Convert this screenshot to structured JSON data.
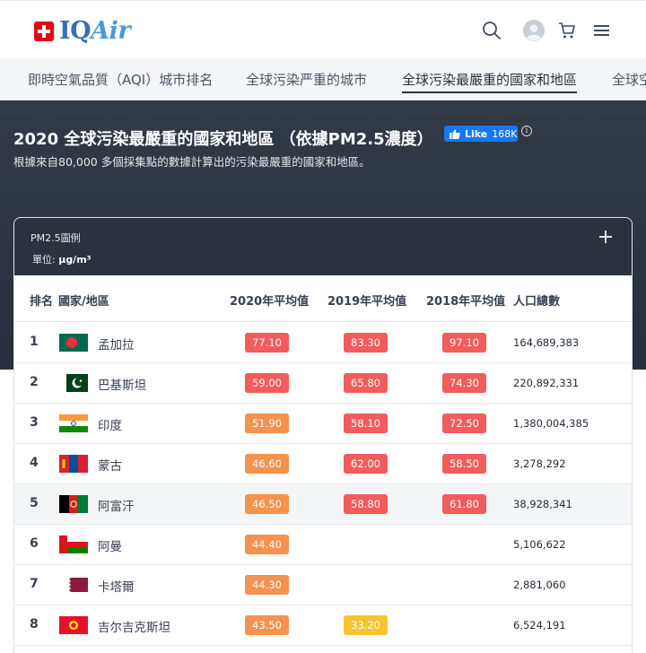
{
  "brand": {
    "name_iq": "IQ",
    "name_air": "Air",
    "flag_color": "#e30613"
  },
  "header_icons": [
    "search-icon",
    "user-avatar-icon",
    "cart-icon",
    "menu-icon"
  ],
  "tabs": [
    {
      "label": "即時空氣品質（AQI）城市排名",
      "active": false
    },
    {
      "label": "全球污染严重的城市",
      "active": false
    },
    {
      "label": "全球污染最嚴重的國家和地區",
      "active": true
    },
    {
      "label": "全球空",
      "active": false
    }
  ],
  "hero": {
    "title": "2020 全球污染最嚴重的國家和地區 （依據PM2.5濃度）",
    "like_label": "Like",
    "like_count": "168K",
    "info_symbol": "i",
    "subtitle": "根據來自80,000 多個採集點的數據計算出的污染最嚴重的國家和地區。"
  },
  "legend": {
    "title": "PM2.5圖例",
    "unit_label": "單位:",
    "unit": "µg/m³"
  },
  "table": {
    "headers": {
      "rank": "排名",
      "country": "國家/地區",
      "y2020": "2020年平均值",
      "y2019": "2019年平均值",
      "y2018": "2018年平均值",
      "population": "人口總數"
    },
    "rows": [
      {
        "rank": "1",
        "flag": "bangladesh",
        "name": "孟加拉",
        "y2020": "77.10",
        "y2019": "83.30",
        "y2018": "97.10",
        "population": "164,689,383",
        "c2020": "red",
        "c2019": "red",
        "c2018": "red"
      },
      {
        "rank": "2",
        "flag": "pakistan",
        "name": "巴基斯坦",
        "y2020": "59.00",
        "y2019": "65.80",
        "y2018": "74.30",
        "population": "220,892,331",
        "c2020": "red",
        "c2019": "red",
        "c2018": "red"
      },
      {
        "rank": "3",
        "flag": "india",
        "name": "印度",
        "y2020": "51.90",
        "y2019": "58.10",
        "y2018": "72.50",
        "population": "1,380,004,385",
        "c2020": "orange",
        "c2019": "red",
        "c2018": "red"
      },
      {
        "rank": "4",
        "flag": "mongolia",
        "name": "蒙古",
        "y2020": "46.60",
        "y2019": "62.00",
        "y2018": "58.50",
        "population": "3,278,292",
        "c2020": "orange",
        "c2019": "red",
        "c2018": "red"
      },
      {
        "rank": "5",
        "flag": "afghanistan",
        "name": "阿富汗",
        "y2020": "46.50",
        "y2019": "58.80",
        "y2018": "61.80",
        "population": "38,928,341",
        "c2020": "orange",
        "c2019": "red",
        "c2018": "red"
      },
      {
        "rank": "6",
        "flag": "oman",
        "name": "阿曼",
        "y2020": "44.40",
        "y2019": "",
        "y2018": "",
        "population": "5,106,622",
        "c2020": "orange",
        "c2019": "",
        "c2018": ""
      },
      {
        "rank": "7",
        "flag": "qatar",
        "name": "卡塔爾",
        "y2020": "44.30",
        "y2019": "",
        "y2018": "",
        "population": "2,881,060",
        "c2020": "orange",
        "c2019": "",
        "c2018": ""
      },
      {
        "rank": "8",
        "flag": "kyrgyzstan",
        "name": "吉尔吉克斯坦",
        "y2020": "43.50",
        "y2019": "33.20",
        "y2018": "",
        "population": "6,524,191",
        "c2020": "orange",
        "c2019": "yellow",
        "c2018": ""
      }
    ]
  },
  "colors": {
    "red": "#f25c5c",
    "orange": "#f5924e",
    "yellow": "#f6c430",
    "like_blue": "#1877f2",
    "hero_bg": "#2b323d"
  }
}
